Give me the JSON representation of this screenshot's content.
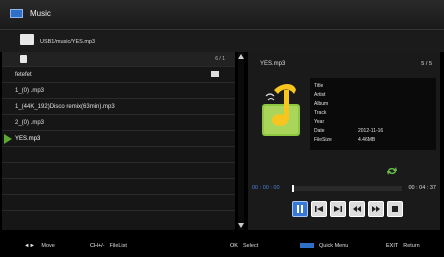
{
  "header": {
    "icon": "music-icon",
    "title": "Music"
  },
  "pathbar": {
    "icon": "folder-icon",
    "path": "USB1/music/YES.mp3"
  },
  "list": {
    "sd_icon": "sd-card-icon",
    "count": "6 / 1",
    "items": [
      {
        "label": "fetefet"
      },
      {
        "label": "1_(0)     .mp3"
      },
      {
        "label": "1_(44K_192)Disco remix(63min).mp3"
      },
      {
        "label": "2_(0)     .mp3"
      },
      {
        "label": "YES.mp3"
      }
    ],
    "selected_index": 4
  },
  "info": {
    "filename": "YES.mp3",
    "index": "5 / 5",
    "art_icon": "music-note-album-art-icon",
    "meta": [
      {
        "key": "Title",
        "value": ""
      },
      {
        "key": "Artist",
        "value": ""
      },
      {
        "key": "Album",
        "value": ""
      },
      {
        "key": "Track",
        "value": ""
      },
      {
        "key": "Year",
        "value": ""
      },
      {
        "key": "Date",
        "value": "2012-11-16"
      },
      {
        "key": "FileSize",
        "value": "4.46MB"
      }
    ]
  },
  "player": {
    "repeat_icon": "repeat-icon",
    "elapsed": "00 : 00 : 00",
    "total": "00 : 04 : 37",
    "progress_fraction": 0.0,
    "controls": [
      {
        "icon": "pause-icon",
        "active": true
      },
      {
        "icon": "previous-icon",
        "active": false
      },
      {
        "icon": "next-icon",
        "active": false
      },
      {
        "icon": "rewind-icon",
        "active": false
      },
      {
        "icon": "fast-forward-icon",
        "active": false
      },
      {
        "icon": "stop-icon",
        "active": false
      }
    ]
  },
  "footer": {
    "move_key": "◄► ",
    "move_label": "Move",
    "ch_key": "CH+/-",
    "ch_label": "FileList",
    "ok_key": "OK",
    "ok_label": "Select",
    "quick_label": "Quick Menu",
    "exit_key": "EXIT",
    "exit_label": "Return"
  },
  "colors": {
    "accent": "#3a78d8",
    "selected_arrow": "#5aa832",
    "art_green": "#8dc63f",
    "art_yellow": "#f7c51d"
  }
}
